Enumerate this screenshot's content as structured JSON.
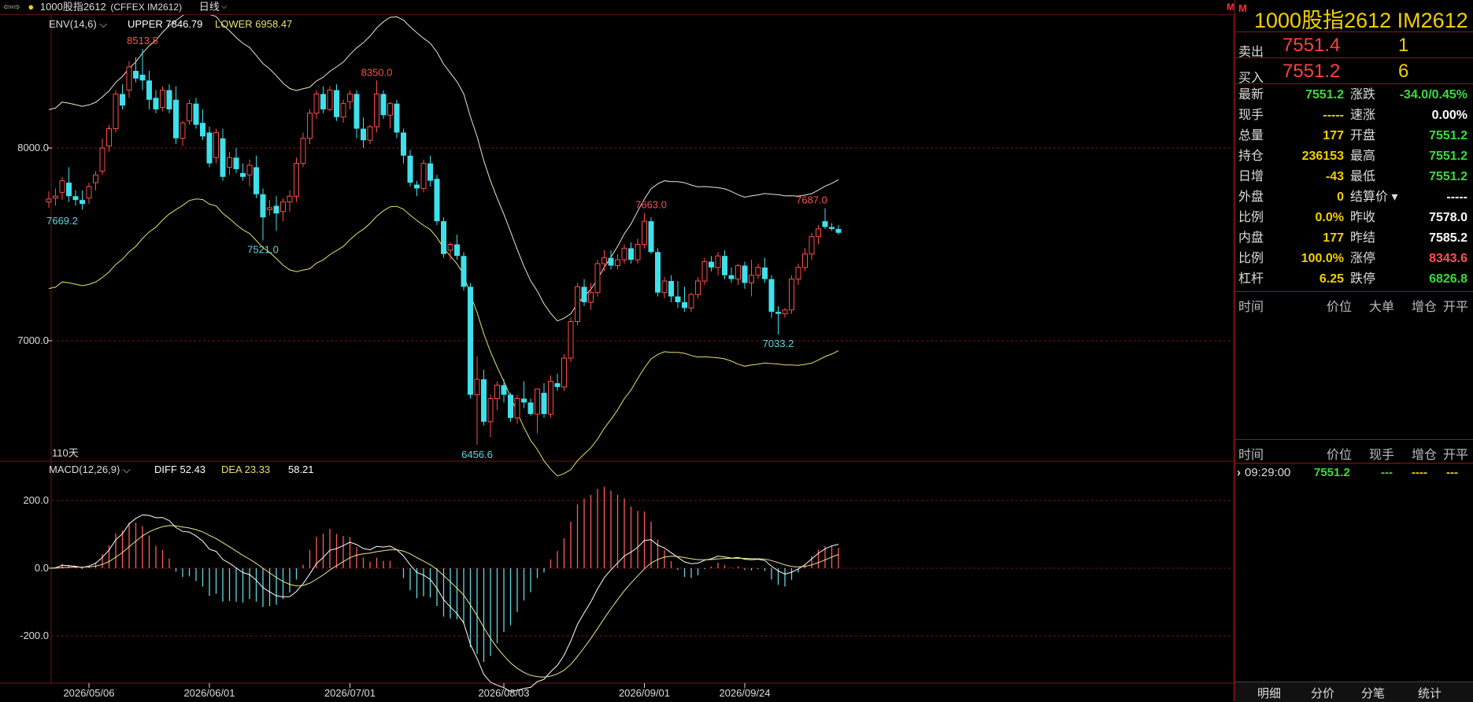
{
  "topbar": {
    "nav_icon": "nav-arrows-icon",
    "instrument": "1000股指2612",
    "exchange": "(CFFEX IM2612)",
    "period": "日线",
    "red_mark": "M"
  },
  "main_chart": {
    "indicator_label": "ENV(14,6)",
    "upper_label": "UPPER 7846.79",
    "lower_label": "LOWER 6958.47",
    "bars_count": "110天",
    "y_ticks": [
      "8000.0",
      "7000.0"
    ],
    "marks": [
      {
        "text": "8513.8",
        "color": "#ff5050"
      },
      {
        "text": "8350.0",
        "color": "#ff5050"
      },
      {
        "text": "7663.0",
        "color": "#ff5050"
      },
      {
        "text": "7687.0",
        "color": "#ff5050"
      },
      {
        "text": "7669.2",
        "color": "#5fd8e0"
      },
      {
        "text": "7521.0",
        "color": "#5fd8e0"
      },
      {
        "text": "6456.6",
        "color": "#5fd8e0"
      },
      {
        "text": "7033.2",
        "color": "#5fd8e0"
      }
    ]
  },
  "macd_panel": {
    "label": "MACD(12,26,9)",
    "diff_label": "DIFF 52.43",
    "dea_label": "DEA 23.33",
    "macd_value": "58.21",
    "y_ticks": [
      "200.0",
      "0.0",
      "-200.0"
    ]
  },
  "x_axis": {
    "dates": [
      "2026/05/06",
      "2026/06/01",
      "2026/07/01",
      "2026/08/03",
      "2026/09/01",
      "2026/09/24"
    ]
  },
  "chart_data": {
    "type": "candlestick",
    "title": "1000股指2612 (CFFEX IM2612) 日线",
    "ylim": [
      6400,
      8560
    ],
    "ohlc": [
      [
        7720,
        7775,
        7690,
        7735
      ],
      [
        7740,
        7790,
        7700,
        7750
      ],
      [
        7770,
        7850,
        7730,
        7830
      ],
      [
        7820,
        7900,
        7720,
        7750
      ],
      [
        7750,
        7780,
        7700,
        7730
      ],
      [
        7730,
        7780,
        7680,
        7710
      ],
      [
        7740,
        7820,
        7710,
        7800
      ],
      [
        7820,
        7880,
        7780,
        7860
      ],
      [
        7880,
        8050,
        7860,
        8000
      ],
      [
        8010,
        8120,
        7980,
        8100
      ],
      [
        8100,
        8300,
        8080,
        8280
      ],
      [
        8280,
        8330,
        8200,
        8220
      ],
      [
        8300,
        8450,
        8260,
        8420
      ],
      [
        8400,
        8470,
        8340,
        8360
      ],
      [
        8380,
        8514,
        8300,
        8350
      ],
      [
        8350,
        8400,
        8200,
        8250
      ],
      [
        8260,
        8300,
        8180,
        8200
      ],
      [
        8210,
        8320,
        8190,
        8300
      ],
      [
        8300,
        8330,
        8180,
        8200
      ],
      [
        8250,
        8320,
        8020,
        8050
      ],
      [
        8050,
        8140,
        8010,
        8130
      ],
      [
        8140,
        8250,
        8120,
        8230
      ],
      [
        8230,
        8260,
        8100,
        8120
      ],
      [
        8130,
        8200,
        8040,
        8060
      ],
      [
        8080,
        8110,
        7900,
        7920
      ],
      [
        7950,
        8100,
        7920,
        8080
      ],
      [
        8050,
        8100,
        7830,
        7850
      ],
      [
        7900,
        7980,
        7860,
        7950
      ],
      [
        7950,
        8000,
        7870,
        7890
      ],
      [
        7870,
        7920,
        7830,
        7850
      ],
      [
        7860,
        7940,
        7800,
        7910
      ],
      [
        7900,
        7960,
        7740,
        7760
      ],
      [
        7760,
        7790,
        7520,
        7640
      ],
      [
        7680,
        7730,
        7650,
        7690
      ],
      [
        7700,
        7750,
        7570,
        7660
      ],
      [
        7670,
        7740,
        7620,
        7720
      ],
      [
        7720,
        7780,
        7670,
        7750
      ],
      [
        7750,
        7950,
        7720,
        7920
      ],
      [
        7920,
        8080,
        7900,
        8050
      ],
      [
        8050,
        8200,
        8020,
        8180
      ],
      [
        8180,
        8300,
        8150,
        8280
      ],
      [
        8280,
        8320,
        8180,
        8200
      ],
      [
        8200,
        8320,
        8190,
        8300
      ],
      [
        8300,
        8330,
        8140,
        8160
      ],
      [
        8160,
        8250,
        8130,
        8230
      ],
      [
        8240,
        8300,
        8200,
        8280
      ],
      [
        8280,
        8300,
        8050,
        8100
      ],
      [
        8100,
        8160,
        8000,
        8040
      ],
      [
        8040,
        8120,
        8020,
        8110
      ],
      [
        8110,
        8350,
        8080,
        8280
      ],
      [
        8280,
        8300,
        8150,
        8170
      ],
      [
        8170,
        8240,
        8100,
        8230
      ],
      [
        8230,
        8250,
        8050,
        8080
      ],
      [
        8080,
        8100,
        7920,
        7960
      ],
      [
        7960,
        7990,
        7800,
        7820
      ],
      [
        7810,
        7830,
        7750,
        7790
      ],
      [
        7790,
        7940,
        7770,
        7920
      ],
      [
        7920,
        7960,
        7800,
        7830
      ],
      [
        7840,
        7860,
        7600,
        7620
      ],
      [
        7620,
        7640,
        7430,
        7450
      ],
      [
        7470,
        7510,
        7420,
        7500
      ],
      [
        7500,
        7550,
        7420,
        7440
      ],
      [
        7440,
        7460,
        7260,
        7280
      ],
      [
        7280,
        7300,
        6700,
        6720
      ],
      [
        6720,
        6920,
        6460,
        6800
      ],
      [
        6800,
        6850,
        6560,
        6580
      ],
      [
        6580,
        6720,
        6500,
        6700
      ],
      [
        6700,
        6790,
        6640,
        6770
      ],
      [
        6770,
        6800,
        6680,
        6720
      ],
      [
        6720,
        6730,
        6580,
        6600
      ],
      [
        6600,
        6720,
        6570,
        6700
      ],
      [
        6700,
        6790,
        6650,
        6680
      ],
      [
        6680,
        6700,
        6610,
        6620
      ],
      [
        6620,
        6750,
        6520,
        6750
      ],
      [
        6730,
        6780,
        6600,
        6620
      ],
      [
        6620,
        6820,
        6600,
        6790
      ],
      [
        6780,
        6830,
        6740,
        6760
      ],
      [
        6760,
        6930,
        6740,
        6910
      ],
      [
        6910,
        7120,
        6890,
        7100
      ],
      [
        7100,
        7300,
        7080,
        7280
      ],
      [
        7280,
        7320,
        7180,
        7200
      ],
      [
        7200,
        7300,
        7160,
        7250
      ],
      [
        7250,
        7420,
        7230,
        7400
      ],
      [
        7400,
        7470,
        7360,
        7430
      ],
      [
        7430,
        7470,
        7370,
        7390
      ],
      [
        7390,
        7450,
        7370,
        7420
      ],
      [
        7420,
        7500,
        7400,
        7480
      ],
      [
        7480,
        7510,
        7400,
        7420
      ],
      [
        7420,
        7530,
        7400,
        7500
      ],
      [
        7500,
        7663,
        7480,
        7620
      ],
      [
        7620,
        7640,
        7450,
        7460
      ],
      [
        7460,
        7480,
        7230,
        7250
      ],
      [
        7250,
        7330,
        7220,
        7310
      ],
      [
        7310,
        7340,
        7200,
        7230
      ],
      [
        7230,
        7310,
        7170,
        7200
      ],
      [
        7200,
        7280,
        7150,
        7170
      ],
      [
        7170,
        7250,
        7150,
        7240
      ],
      [
        7240,
        7330,
        7220,
        7310
      ],
      [
        7310,
        7430,
        7290,
        7410
      ],
      [
        7410,
        7440,
        7360,
        7380
      ],
      [
        7380,
        7460,
        7340,
        7440
      ],
      [
        7440,
        7470,
        7320,
        7340
      ],
      [
        7340,
        7380,
        7300,
        7320
      ],
      [
        7320,
        7400,
        7290,
        7390
      ],
      [
        7390,
        7410,
        7270,
        7300
      ],
      [
        7300,
        7420,
        7230,
        7340
      ],
      [
        7340,
        7400,
        7320,
        7380
      ],
      [
        7380,
        7430,
        7300,
        7320
      ],
      [
        7320,
        7340,
        7120,
        7150
      ],
      [
        7150,
        7180,
        7033,
        7140
      ],
      [
        7140,
        7170,
        7120,
        7160
      ],
      [
        7160,
        7340,
        7140,
        7320
      ],
      [
        7320,
        7400,
        7290,
        7380
      ],
      [
        7380,
        7480,
        7360,
        7450
      ],
      [
        7450,
        7560,
        7420,
        7540
      ],
      [
        7540,
        7600,
        7500,
        7580
      ],
      [
        7620,
        7687,
        7580,
        7590
      ],
      [
        7590,
        7610,
        7570,
        7580
      ],
      [
        7580,
        7600,
        7550,
        7560
      ]
    ]
  },
  "right_panel": {
    "flag": "M",
    "title": "1000股指2612  IM2612",
    "sell": {
      "label": "卖出",
      "price": "7551.4",
      "vol": "1"
    },
    "buy": {
      "label": "买入",
      "price": "7551.2",
      "vol": "6"
    },
    "quotes": [
      {
        "k1": "最新",
        "v1": "7551.2",
        "c1": "#3adc3a",
        "k2": "涨跌",
        "v2": "-34.0/0.45%",
        "c2": "#3adc3a"
      },
      {
        "k1": "现手",
        "v1": "-----",
        "c1": "#f0d000",
        "k2": "速涨",
        "v2": "0.00%",
        "c2": "#ffffff"
      },
      {
        "k1": "总量",
        "v1": "177",
        "c1": "#f0d000",
        "k2": "开盘",
        "v2": "7551.2",
        "c2": "#3adc3a"
      },
      {
        "k1": "持仓",
        "v1": "236153",
        "c1": "#f0d000",
        "k2": "最高",
        "v2": "7551.2",
        "c2": "#3adc3a"
      },
      {
        "k1": "日增",
        "v1": "-43",
        "c1": "#f0d000",
        "k2": "最低",
        "v2": "7551.2",
        "c2": "#3adc3a"
      },
      {
        "k1": "外盘",
        "v1": "0",
        "c1": "#f0d000",
        "k2": "结算价",
        "v2": "-----",
        "c2": "#ffffff"
      },
      {
        "k1": "比例",
        "v1": "0.0%",
        "c1": "#f0d000",
        "k2": "昨收",
        "v2": "7578.0",
        "c2": "#ffffff"
      },
      {
        "k1": "内盘",
        "v1": "177",
        "c1": "#f0d000",
        "k2": "昨结",
        "v2": "7585.2",
        "c2": "#ffffff"
      },
      {
        "k1": "比例",
        "v1": "100.0%",
        "c1": "#f0d000",
        "k2": "涨停",
        "v2": "8343.6",
        "c2": "#ff5050"
      },
      {
        "k1": "杠杆",
        "v1": "6.25",
        "c1": "#f0d000",
        "k2": "跌停",
        "v2": "6826.8",
        "c2": "#3adc3a"
      }
    ],
    "big_orders_header": [
      "时间",
      "价位",
      "大单",
      "增仓",
      "开平"
    ],
    "ticks_header": [
      "时间",
      "价位",
      "现手",
      "增仓",
      "开平"
    ],
    "tick_row": {
      "time": "09:29:00",
      "price": "7551.2",
      "vol": "---",
      "oi": "----",
      "oc": "---"
    },
    "tabs": [
      "明细",
      "分价",
      "分笔",
      "统计"
    ]
  }
}
